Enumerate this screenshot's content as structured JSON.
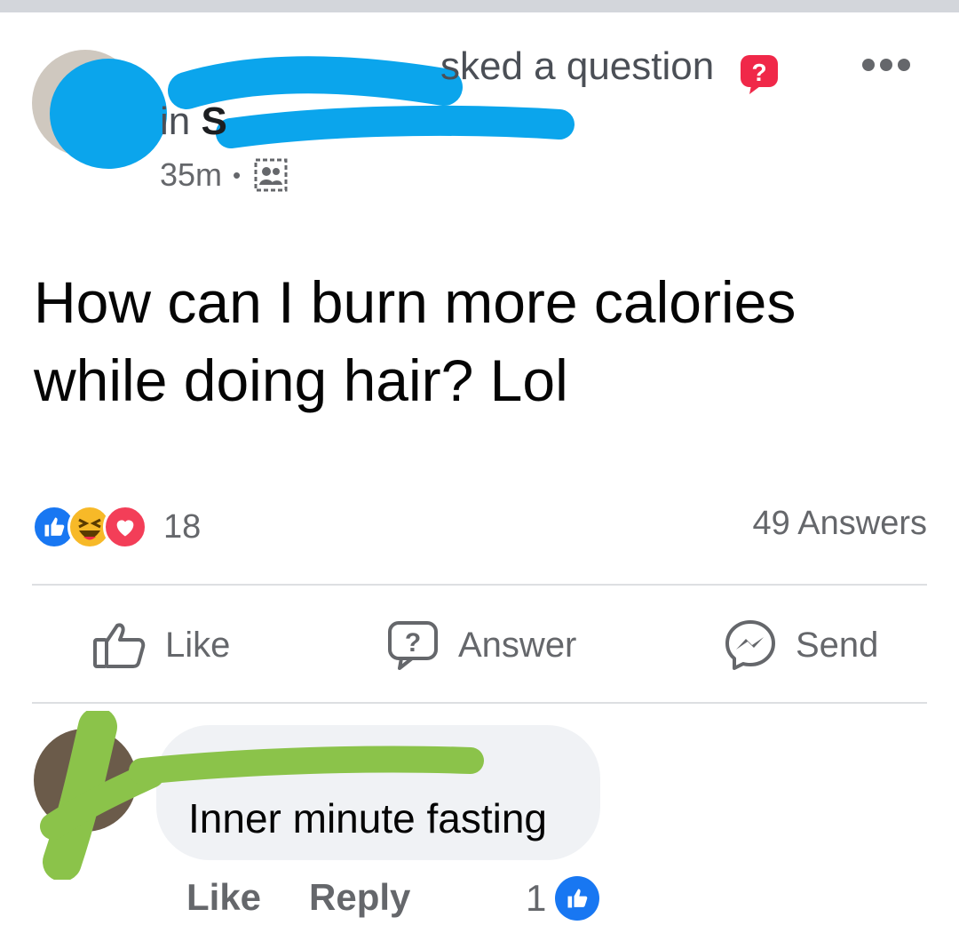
{
  "post": {
    "header_suffix": "sked a question",
    "group_prefix": "in",
    "group_initial": "S",
    "time": "35m",
    "text": "How can I burn more calories while doing hair? Lol"
  },
  "reactions": {
    "count": "18",
    "answers": "49 Answers"
  },
  "actions": {
    "like": "Like",
    "answer": "Answer",
    "send": "Send"
  },
  "comment": {
    "text": "Inner minute fasting",
    "like": "Like",
    "reply": "Reply",
    "likes": "1"
  },
  "colors": {
    "facebook_blue": "#1877f2",
    "redact_blue": "#0ba5ec",
    "redact_green": "#8bc34a"
  }
}
